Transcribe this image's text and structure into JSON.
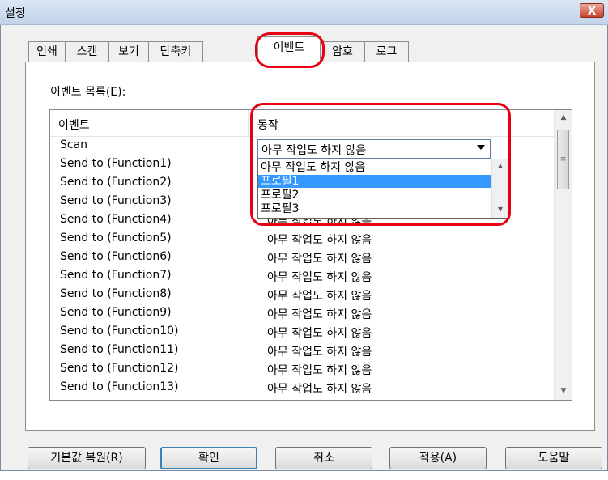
{
  "window": {
    "title": "설정",
    "close_label": "X"
  },
  "tabs": [
    {
      "label": "인쇄",
      "active": false
    },
    {
      "label": "스캔",
      "active": false
    },
    {
      "label": "보기",
      "active": false
    },
    {
      "label": "단축키",
      "active": false
    },
    {
      "label": "이벤트",
      "active": true
    },
    {
      "label": "암호",
      "active": false
    },
    {
      "label": "로그",
      "active": false
    }
  ],
  "event_list": {
    "label": "이벤트 목록(E):",
    "columns": {
      "event": "이벤트",
      "action": "동작"
    },
    "rows": [
      {
        "event": "Scan",
        "action": "아무 작업도 하지 않음"
      },
      {
        "event": "Send to (Function1)",
        "action": "아무 작업도 하지 않음"
      },
      {
        "event": "Send to (Function2)",
        "action": "아무 작업도 하지 않음"
      },
      {
        "event": "Send to (Function3)",
        "action": "아무 작업도 하지 않음"
      },
      {
        "event": "Send to (Function4)",
        "action": "아무 작업도 하지 않음"
      },
      {
        "event": "Send to (Function5)",
        "action": "아무 작업도 하지 않음"
      },
      {
        "event": "Send to (Function6)",
        "action": "아무 작업도 하지 않음"
      },
      {
        "event": "Send to (Function7)",
        "action": "아무 작업도 하지 않음"
      },
      {
        "event": "Send to (Function8)",
        "action": "아무 작업도 하지 않음"
      },
      {
        "event": "Send to (Function9)",
        "action": "아무 작업도 하지 않음"
      },
      {
        "event": "Send to (Function10)",
        "action": "아무 작업도 하지 않음"
      },
      {
        "event": "Send to (Function11)",
        "action": "아무 작업도 하지 않음"
      },
      {
        "event": "Send to (Function12)",
        "action": "아무 작업도 하지 않음"
      },
      {
        "event": "Send to (Function13)",
        "action": "아무 작업도 하지 않음"
      }
    ]
  },
  "action_combo": {
    "selected": "아무 작업도 하지 않음",
    "options": [
      {
        "label": "아무 작업도 하지 않음",
        "highlighted": false
      },
      {
        "label": "프로필1",
        "highlighted": true
      },
      {
        "label": "프로필2",
        "highlighted": false
      },
      {
        "label": "프로필3",
        "highlighted": false
      }
    ]
  },
  "buttons": {
    "reset": "기본값 복원(R)",
    "ok": "확인",
    "cancel": "취소",
    "apply": "적용(A)",
    "help": "도움말"
  },
  "colors": {
    "highlight_outline": "#e60012",
    "selection": "#3399ff"
  }
}
